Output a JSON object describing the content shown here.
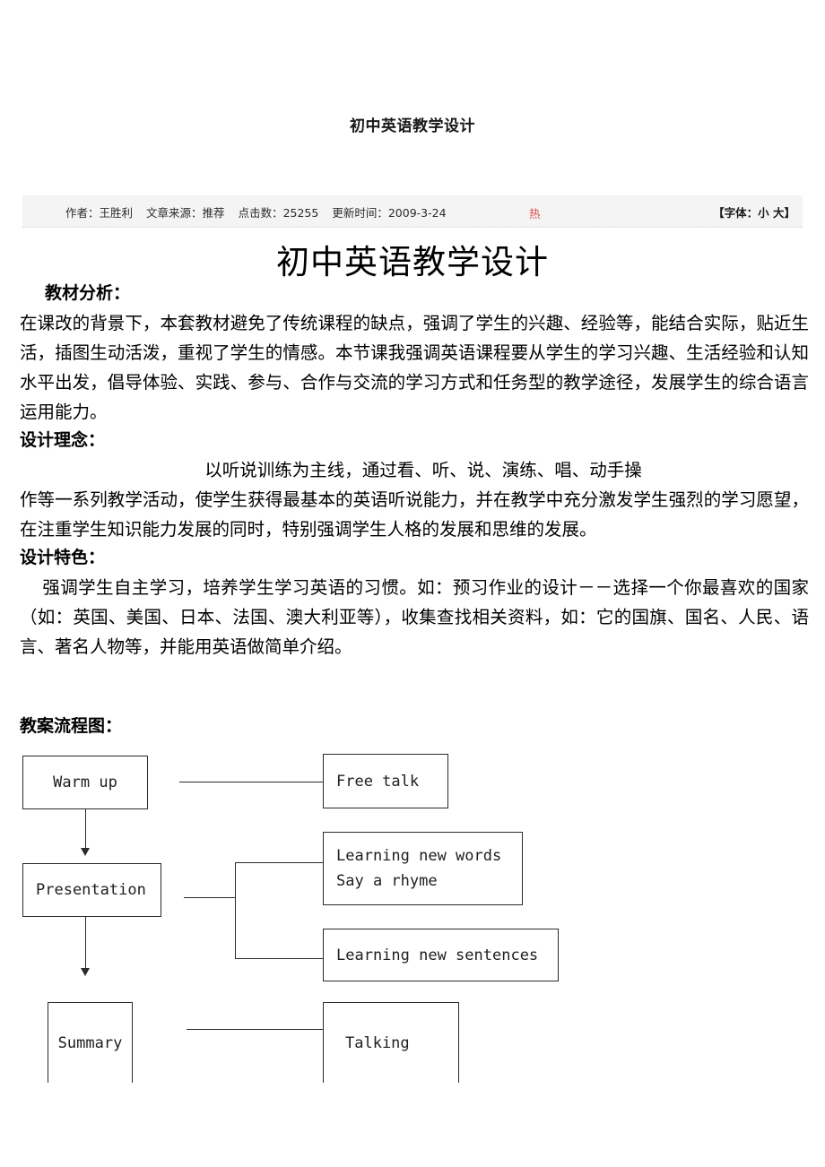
{
  "header": {
    "small_title": "初中英语教学设计"
  },
  "meta": {
    "author_label": "作者：",
    "author": "王胜利",
    "source_label": "文章来源：",
    "source": "推荐",
    "hits_label": "点击数：",
    "hits": "25255",
    "updated_label": "更新时间：",
    "updated": "2009-3-24",
    "hot_badge": "热",
    "font_control": "【字体：小 大】",
    "hot_color": "#e04a4a",
    "bar_bg": "#f4f4f4"
  },
  "article": {
    "title": "初中英语教学设计",
    "sections": [
      {
        "heading": "教材分析：",
        "heading_indent": true,
        "paragraphs": [
          "在课改的背景下，本套教材避免了传统课程的缺点，强调了学生的兴趣、经验等，能结合实际，贴近生活，插图生动活泼，重视了学生的情感。本节课我强调英语课程要从学生的学习兴趣、生活经验和认知水平出发，倡导体验、实践、参与、合作与交流的学习方式和任务型的教学途径，发展学生的综合语言运用能力。"
        ]
      },
      {
        "heading": "设计理念：",
        "heading_indent": false,
        "center_line": "以听说训练为主线，通过看、听、说、演练、唱、动手操",
        "paragraphs": [
          "作等一系列教学活动，使学生获得最基本的英语听说能力，并在教学中充分激发学生强烈的学习愿望，在注重学生知识能力发展的同时，特别强调学生人格的发展和思维的发展。"
        ]
      },
      {
        "heading": "设计特色：",
        "heading_indent": false,
        "paragraphs": [
          "强调学生自主学习，培养学生学习英语的习惯。如：预习作业的设计－－选择一个你最喜欢的国家（如：英国、美国、日本、法国、澳大利亚等），收集查找相关资料，如：它的国旗、国名、人民、语言、著名人物等，并能用英语做简单介绍。"
        ]
      }
    ]
  },
  "flowchart": {
    "heading": "教案流程图：",
    "nodes": [
      {
        "id": "warm-up",
        "lines": [
          "Warm up"
        ]
      },
      {
        "id": "free-talk",
        "lines": [
          "Free talk"
        ]
      },
      {
        "id": "presentation",
        "lines": [
          "Presentation"
        ]
      },
      {
        "id": "learning-new-words",
        "lines": [
          "Learning new words",
          "Say a rhyme"
        ]
      },
      {
        "id": "learning-new-sentences",
        "lines": [
          "Learning new sentences"
        ]
      },
      {
        "id": "summary",
        "lines": [
          "Summary"
        ]
      },
      {
        "id": "talking",
        "lines": [
          "Talking"
        ]
      }
    ]
  }
}
